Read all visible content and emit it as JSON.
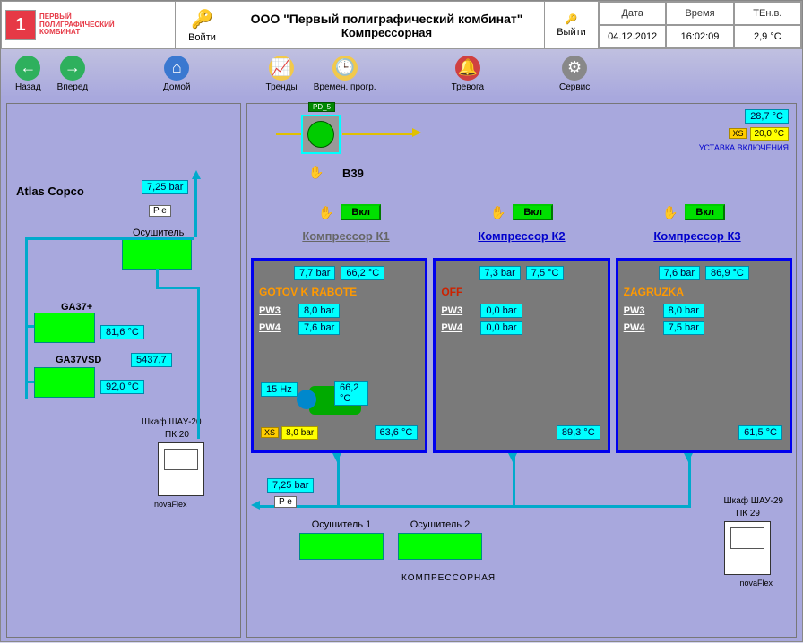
{
  "header": {
    "logo_l1": "ПЕРВЫЙ",
    "logo_l2": "ПОЛИГРАФИЧЕСКИЙ",
    "logo_l3": "КОМБИНАТ",
    "login_label": "Войти",
    "title_l1": "ООО \"Первый полиграфический комбинат\"",
    "title_l2": "Компрессорная",
    "exit_label": "Выйти",
    "date_hdr": "Дата",
    "time_hdr": "Время",
    "temp_hdr": "ТЕн.в.",
    "date_val": "04.12.2012",
    "time_val": "16:02:09",
    "temp_val": "2,9   °C"
  },
  "toolbar": {
    "back": "Назад",
    "fwd": "Вперед",
    "home": "Домой",
    "trends": "Тренды",
    "tprog": "Времен. прогр.",
    "alarm": "Тревога",
    "service": "Сервис"
  },
  "left": {
    "title": "Atlas Copco",
    "pressure": "7,25 bar",
    "pe": "P  e",
    "osu_lbl": "Осушитель",
    "ga37_lbl": "GA37+",
    "ga37_temp": "81,6   °C",
    "ga37vsd_lbl": "GA37VSD",
    "ga37vsd_val": "5437,7",
    "ga37vsd_temp": "92,0   °C",
    "cab_lbl": "Шкаф ШАУ-20",
    "cab_pk": "ПК 20",
    "cab_nf": "novaFlex"
  },
  "right": {
    "temp1": "28,7   °C",
    "ust_xs": "XS",
    "ust_val": "20,0   °C",
    "ust_lbl": "УСТАВКА ВКЛЮЧЕНИЯ",
    "pd": "PD_5",
    "valve_lbl": "B39",
    "onoff": {
      "c1": "Вкл",
      "c2": "Вкл",
      "c3": "Вкл"
    },
    "titles": {
      "c1": "Компрессор К1",
      "c2": "Компрессор К2",
      "c3": "Компрессор К3"
    },
    "c1": {
      "bar": "7,7  bar",
      "temp": "66,2  °C",
      "status": "GOTOV K RABOTE",
      "pw3l": "PW3",
      "pw3": "8,0  bar",
      "pw4l": "PW4",
      "pw4": "7,6  bar",
      "hz": "15   Hz",
      "motor_temp": "66,2  °C",
      "xs": "XS",
      "xs_bar": "8,0   bar",
      "btm_temp": "63,6   °C"
    },
    "c2": {
      "bar": "7,3  bar",
      "temp": "7,5  °C",
      "status": "OFF",
      "pw3l": "PW3",
      "pw3": "0,0  bar",
      "pw4l": "PW4",
      "pw4": "0,0  bar",
      "btm_temp": "89,3   °C"
    },
    "c3": {
      "bar": "7,6  bar",
      "temp": "86,9  °C",
      "status": "ZAGRUZKA",
      "pw3l": "PW3",
      "pw3": "8,0  bar",
      "pw4l": "PW4",
      "pw4": "7,5  bar",
      "btm_temp": "61,5   °C"
    },
    "pressure2": "7,25 bar",
    "pe2": "P  e",
    "dry1_lbl": "Осушитель 1",
    "dry2_lbl": "Осушитель 2",
    "room_lbl": "КОМПРЕССОРНАЯ",
    "cab29_lbl": "Шкаф ШАУ-29",
    "cab29_pk": "ПК 29",
    "cab29_nf": "novaFlex"
  }
}
